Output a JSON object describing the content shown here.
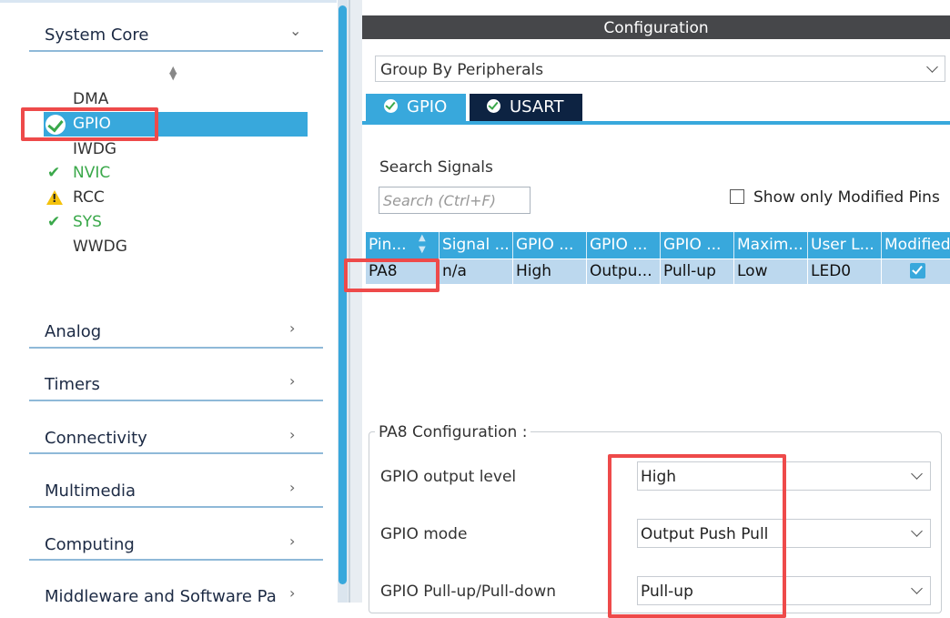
{
  "sidebar": {
    "categories": [
      {
        "label": "System Core",
        "expanded": true
      },
      {
        "label": "Analog"
      },
      {
        "label": "Timers"
      },
      {
        "label": "Connectivity"
      },
      {
        "label": "Multimedia"
      },
      {
        "label": "Computing"
      },
      {
        "label": "Middleware and Software Pa"
      }
    ],
    "items": [
      {
        "label": "DMA",
        "status": "none"
      },
      {
        "label": "GPIO",
        "status": "ok",
        "selected": true
      },
      {
        "label": "IWDG",
        "status": "none"
      },
      {
        "label": "NVIC",
        "status": "ok"
      },
      {
        "label": "RCC",
        "status": "warning"
      },
      {
        "label": "SYS",
        "status": "ok"
      },
      {
        "label": "WWDG",
        "status": "none"
      }
    ]
  },
  "config": {
    "header": "Configuration",
    "group_by": "Group By Peripherals",
    "tabs": [
      {
        "label": "GPIO",
        "active": true
      },
      {
        "label": "USART",
        "active": false
      }
    ],
    "search_label": "Search Signals",
    "search_placeholder": "Search (Ctrl+F)",
    "show_modified_label": "Show only Modified Pins",
    "table": {
      "headers": [
        "Pin...",
        "Signal ...",
        "GPIO ...",
        "GPIO ...",
        "GPIO ...",
        "Maxim...",
        "User L...",
        "Modified"
      ],
      "rows": [
        {
          "pin": "PA8",
          "signal": "n/a",
          "gpio_output_level": "High",
          "gpio_mode": "Outpu...",
          "gpio_pull": "Pull-up",
          "max_speed": "Low",
          "user_label": "LED0",
          "modified": true
        }
      ]
    },
    "pin_config": {
      "title": "PA8 Configuration :",
      "fields": [
        {
          "label": "GPIO output level",
          "value": "High"
        },
        {
          "label": "GPIO mode",
          "value": "Output Push Pull"
        },
        {
          "label": "GPIO Pull-up/Pull-down",
          "value": "Pull-up"
        }
      ]
    }
  },
  "colors": {
    "accent": "#38a8dc",
    "highlight": "#ee4a4a",
    "ok": "#3aa84a",
    "warning": "#f4c20d",
    "header": "#46474a",
    "active_tab": "#0d2342"
  }
}
